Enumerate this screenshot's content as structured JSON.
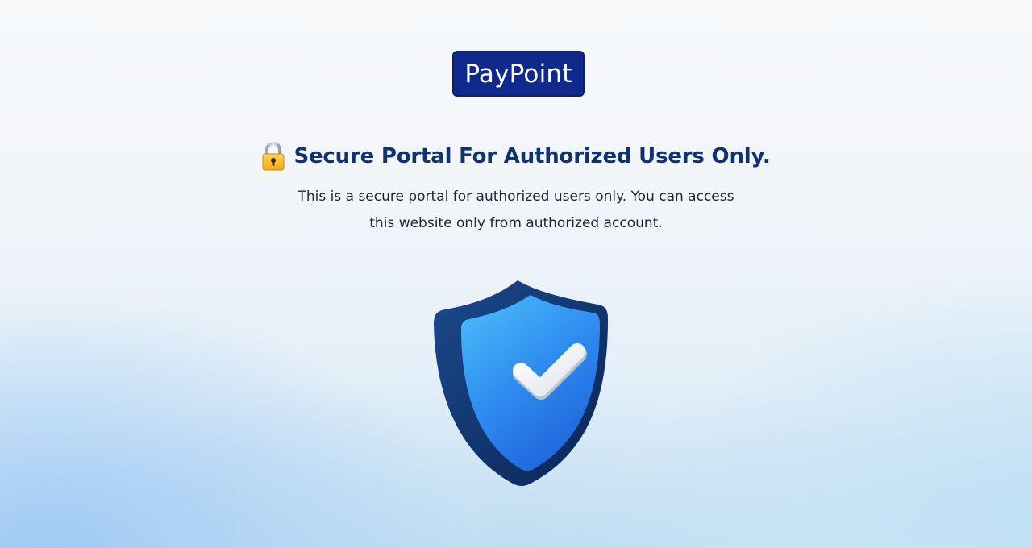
{
  "brand": {
    "logo_text": "PayPoint",
    "color": "#0f2a8c"
  },
  "heading": {
    "icon": "lock-icon",
    "text": "Secure Portal For Authorized Users Only.",
    "color": "#0e3272"
  },
  "description": {
    "line1": "This is a secure portal for authorized users only. You can access",
    "line2": "this website only from authorized account."
  },
  "illustration": {
    "icon": "shield-check-icon",
    "primary_color": "#2a8cf0",
    "outline_color": "#0d2e63"
  }
}
